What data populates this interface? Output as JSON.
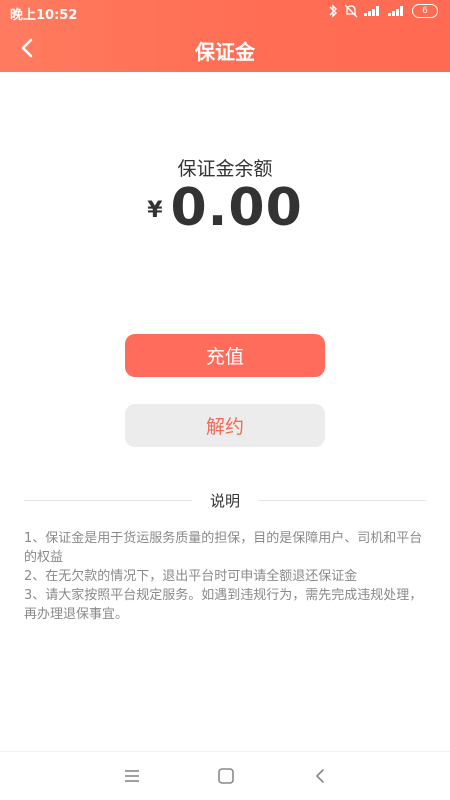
{
  "status_bar": {
    "time": "晚上10:52",
    "battery": "6",
    "network": "4G"
  },
  "header": {
    "title": "保证金"
  },
  "balance": {
    "label": "保证金余额",
    "currency": "¥",
    "amount": "0.00"
  },
  "actions": {
    "recharge": "充值",
    "cancel": "解约"
  },
  "notes": {
    "title": "说明",
    "items": [
      "1、保证金是用于货运服务质量的担保，目的是保障用户、司机和平台的权益",
      "2、在无欠款的情况下，退出平台时可申请全额退还保证金",
      "3、请大家按照平台规定服务。如遇到违规行为，需先完成违规处理，再办理退保事宜。"
    ]
  },
  "icons": {
    "back": "back-arrow-icon",
    "menu": "menu-icon",
    "home": "home-icon",
    "system_back": "system-back-icon"
  }
}
